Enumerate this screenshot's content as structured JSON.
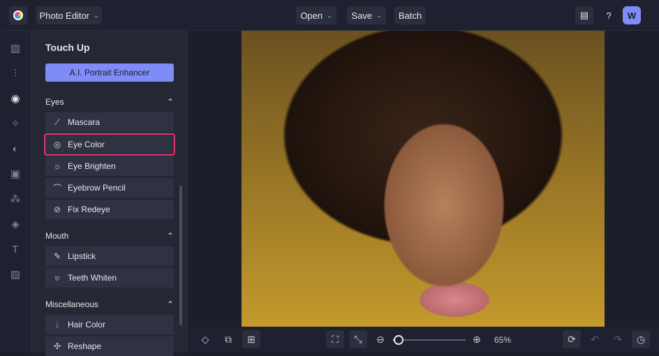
{
  "header": {
    "app_menu": "Photo Editor",
    "open": "Open",
    "save": "Save",
    "batch": "Batch",
    "avatar": "W"
  },
  "panel": {
    "title": "Touch Up",
    "ai_button": "A.I. Portrait Enhancer",
    "sections": [
      {
        "label": "Eyes",
        "items": [
          "Mascara",
          "Eye Color",
          "Eye Brighten",
          "Eyebrow Pencil",
          "Fix Redeye"
        ]
      },
      {
        "label": "Mouth",
        "items": [
          "Lipstick",
          "Teeth Whiten"
        ]
      },
      {
        "label": "Miscellaneous",
        "items": [
          "Hair Color",
          "Reshape"
        ]
      }
    ],
    "selected": "Eye Color"
  },
  "zoom": {
    "label": "65%",
    "slider_fraction": 0.08
  },
  "colors": {
    "accent": "#7f8cf7",
    "selection": "#e2336b"
  }
}
